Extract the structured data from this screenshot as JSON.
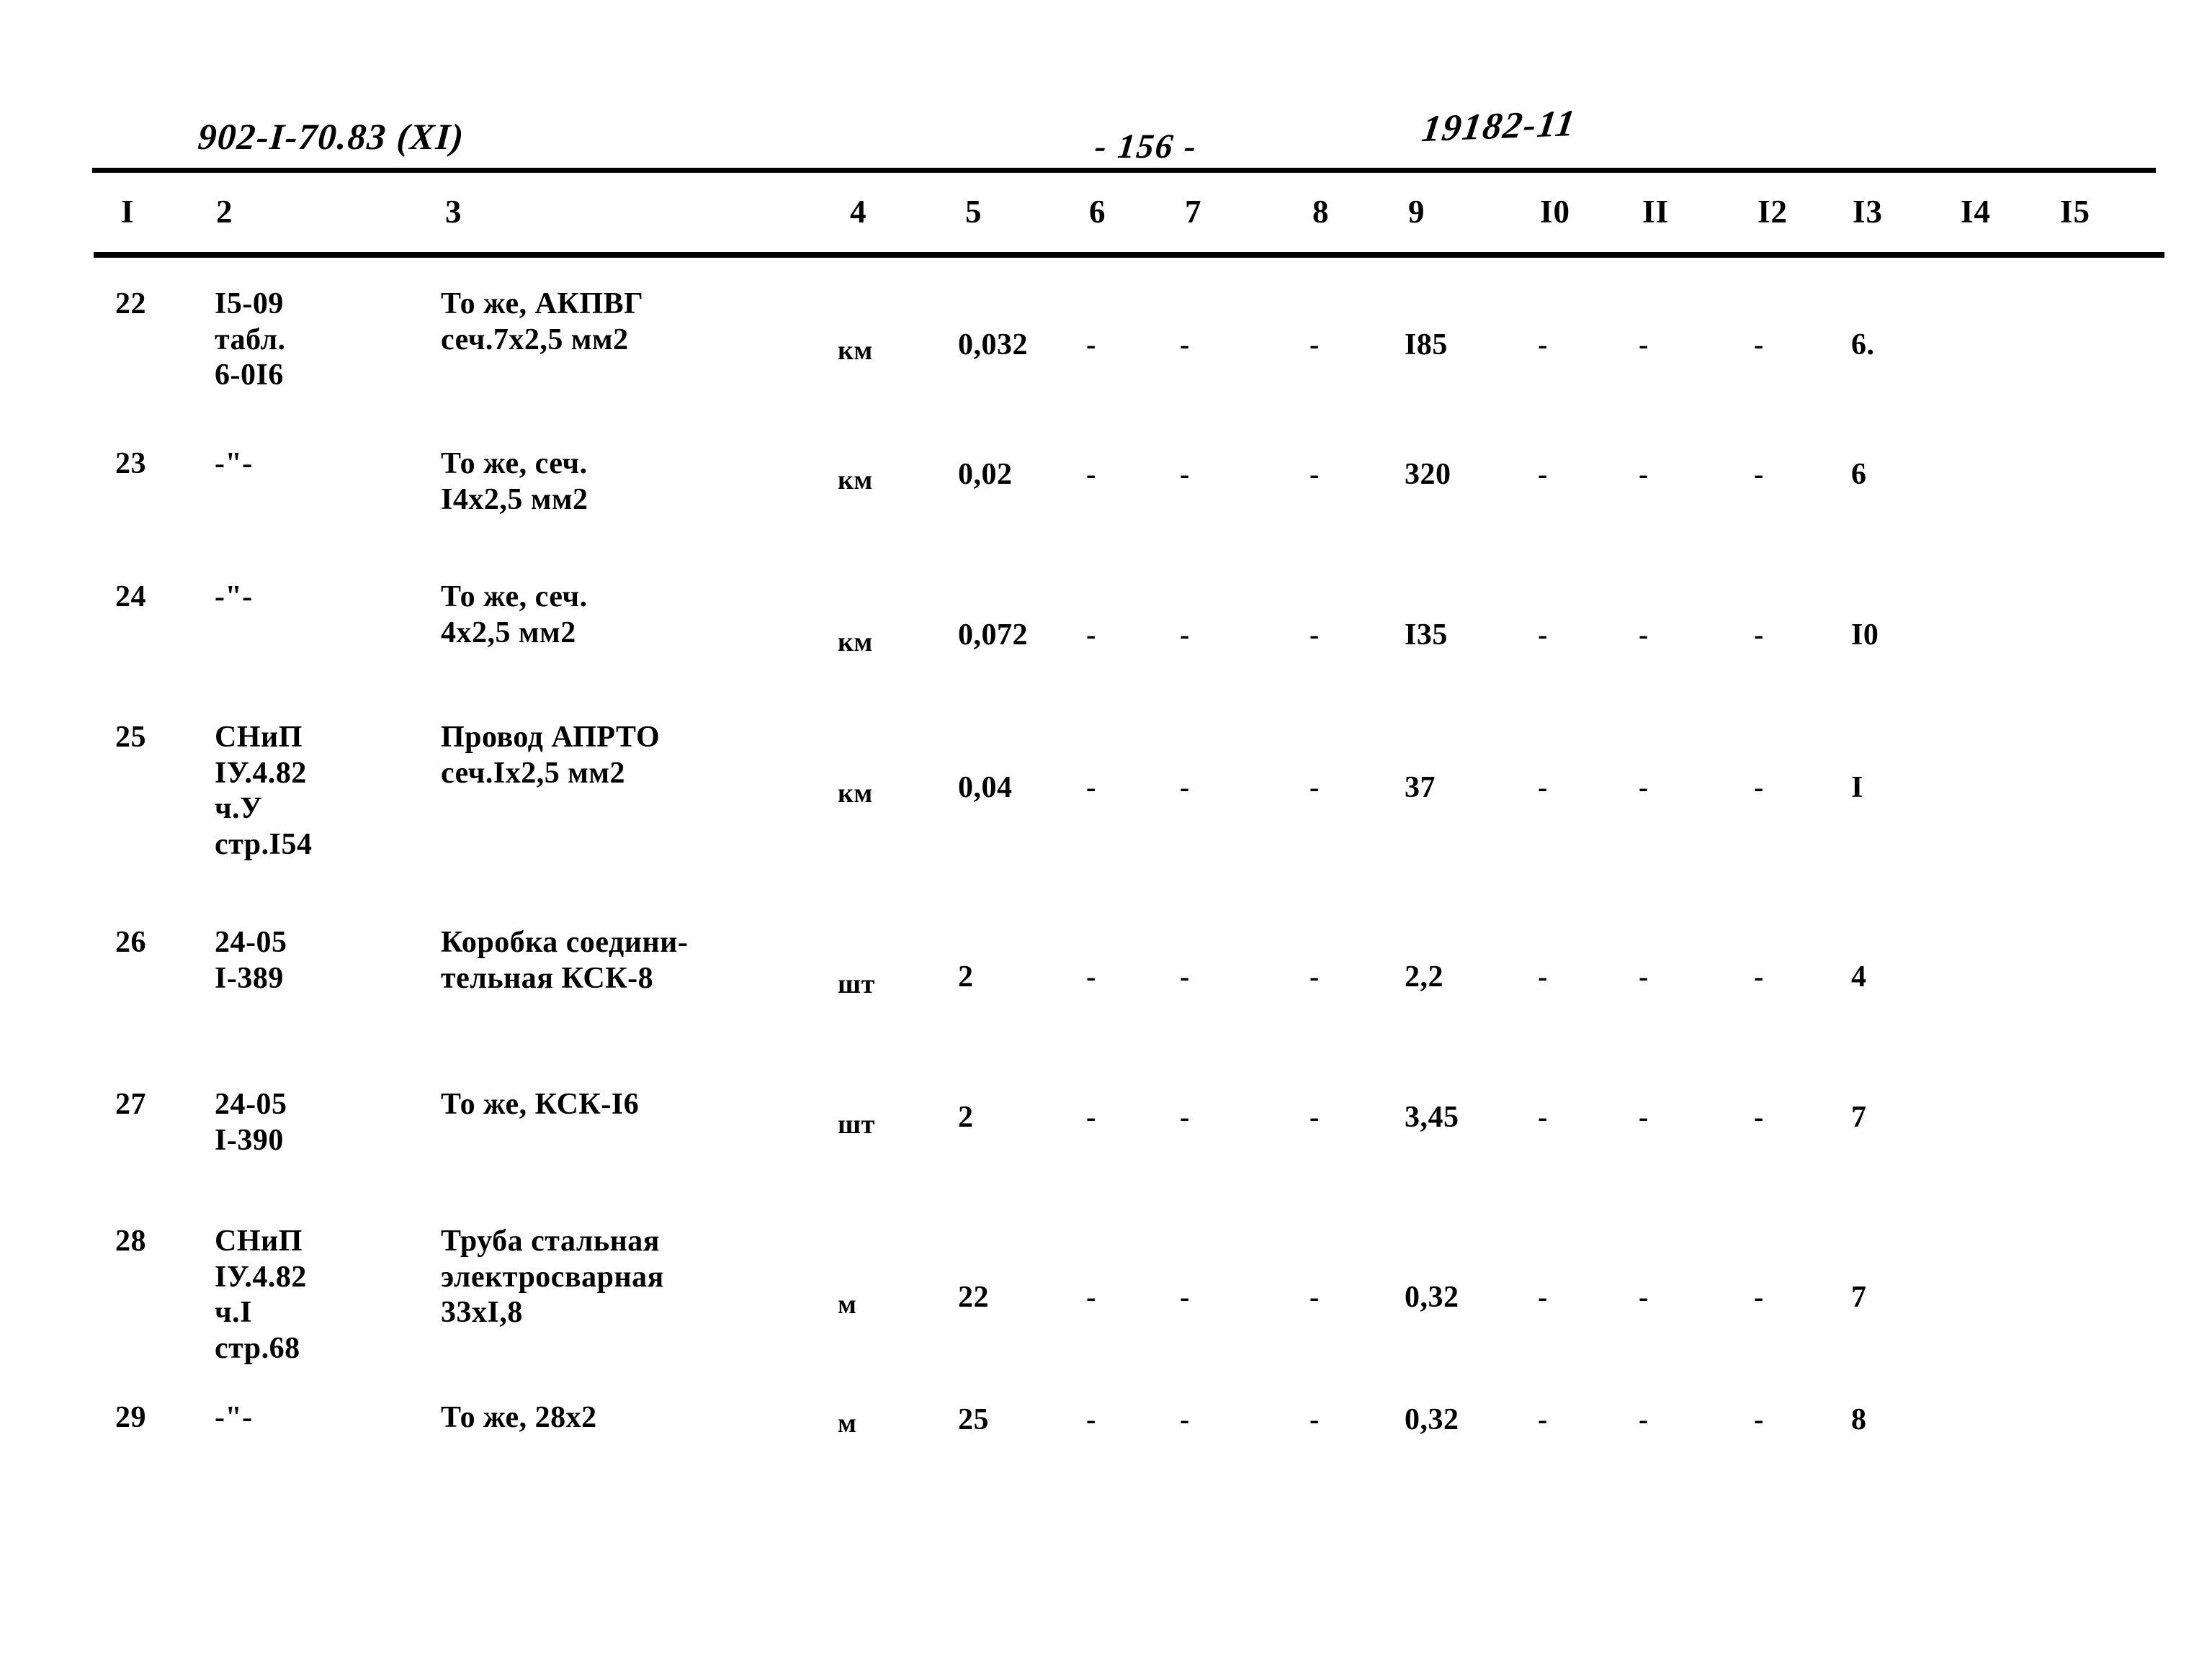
{
  "header": {
    "doc_code": "902-I-70.83  (XI)",
    "page_number": "- 156 -",
    "hand_code": "19182-11"
  },
  "table": {
    "column_headers": [
      "I",
      "2",
      "3",
      "4",
      "5",
      "6",
      "7",
      "8",
      "9",
      "I0",
      "II",
      "I2",
      "I3",
      "I4",
      "I5"
    ],
    "rows": [
      {
        "pos": "22",
        "ref": "I5-09\nтабл.\n6-0I6",
        "name": "То же, АКПВГ\nсеч.7х2,5 мм2",
        "unit": "км",
        "c5": "0,032",
        "c6": "-",
        "c7": "-",
        "c8": "-",
        "c9": "I85",
        "c10": "-",
        "c11": "-",
        "c12": "-",
        "c13": "6.",
        "c14": "",
        "c15": ""
      },
      {
        "pos": "23",
        "ref": "-\"-",
        "name": "То же, сеч.\nI4х2,5 мм2",
        "unit": "км",
        "c5": "0,02",
        "c6": "-",
        "c7": "-",
        "c8": "-",
        "c9": "320",
        "c10": "-",
        "c11": "-",
        "c12": "-",
        "c13": "6",
        "c14": "",
        "c15": ""
      },
      {
        "pos": "24",
        "ref": "-\"-",
        "name": "То же, сеч.\n4х2,5 мм2",
        "unit": "км",
        "c5": "0,072",
        "c6": "-",
        "c7": "-",
        "c8": "-",
        "c9": "I35",
        "c10": "-",
        "c11": "-",
        "c12": "-",
        "c13": "I0",
        "c14": "",
        "c15": ""
      },
      {
        "pos": "25",
        "ref": "СНиП\nIУ.4.82\nч.У\nстр.I54",
        "name": "Провод АПРТО\nсеч.Iх2,5 мм2",
        "unit": "км",
        "c5": "0,04",
        "c6": "-",
        "c7": "-",
        "c8": "-",
        "c9": "37",
        "c10": "-",
        "c11": "-",
        "c12": "-",
        "c13": "I",
        "c14": "",
        "c15": ""
      },
      {
        "pos": "26",
        "ref": "24-05\nI-389",
        "name": "Коробка соедини-\nтельная КСК-8",
        "unit": "шт",
        "c5": "2",
        "c6": "-",
        "c7": "-",
        "c8": "-",
        "c9": "2,2",
        "c10": "-",
        "c11": "-",
        "c12": "-",
        "c13": "4",
        "c14": "",
        "c15": ""
      },
      {
        "pos": "27",
        "ref": "24-05\nI-390",
        "name": "То же, КСК-I6",
        "unit": "шт",
        "c5": "2",
        "c6": "-",
        "c7": "-",
        "c8": "-",
        "c9": "3,45",
        "c10": "-",
        "c11": "-",
        "c12": "-",
        "c13": "7",
        "c14": "",
        "c15": ""
      },
      {
        "pos": "28",
        "ref": "СНиП\nIУ.4.82\nч.I\nстр.68",
        "name": "Труба стальная\nэлектросварная\n33хI,8",
        "unit": "м",
        "c5": "22",
        "c6": "-",
        "c7": "-",
        "c8": "-",
        "c9": "0,32",
        "c10": "-",
        "c11": "-",
        "c12": "-",
        "c13": "7",
        "c14": "",
        "c15": ""
      },
      {
        "pos": "29",
        "ref": "-\"-",
        "name": "То же, 28х2",
        "unit": "м",
        "c5": "25",
        "c6": "-",
        "c7": "-",
        "c8": "-",
        "c9": "0,32",
        "c10": "-",
        "c11": "-",
        "c12": "-",
        "c13": "8",
        "c14": "",
        "c15": ""
      }
    ]
  },
  "layout": {
    "col_x": [
      160,
      298,
      612,
      1163,
      1330,
      1508,
      1638,
      1818,
      1950,
      2135,
      2275,
      2435,
      2570,
      2720,
      2855
    ],
    "header_x": [
      168,
      300,
      618,
      1180,
      1340,
      1512,
      1645,
      1822,
      1955,
      2138,
      2280,
      2440,
      2572,
      2722,
      2860
    ],
    "row_y": [
      398,
      620,
      805,
      1000,
      1285,
      1510,
      1700,
      1945
    ],
    "row_unit_y": [
      465,
      645,
      870,
      1080,
      1345,
      1540,
      1790,
      1955
    ],
    "row_num_y": [
      455,
      635,
      858,
      1070,
      1333,
      1528,
      1778,
      1948
    ]
  },
  "colors": {
    "ink": "#000000",
    "paper": "#ffffff"
  }
}
